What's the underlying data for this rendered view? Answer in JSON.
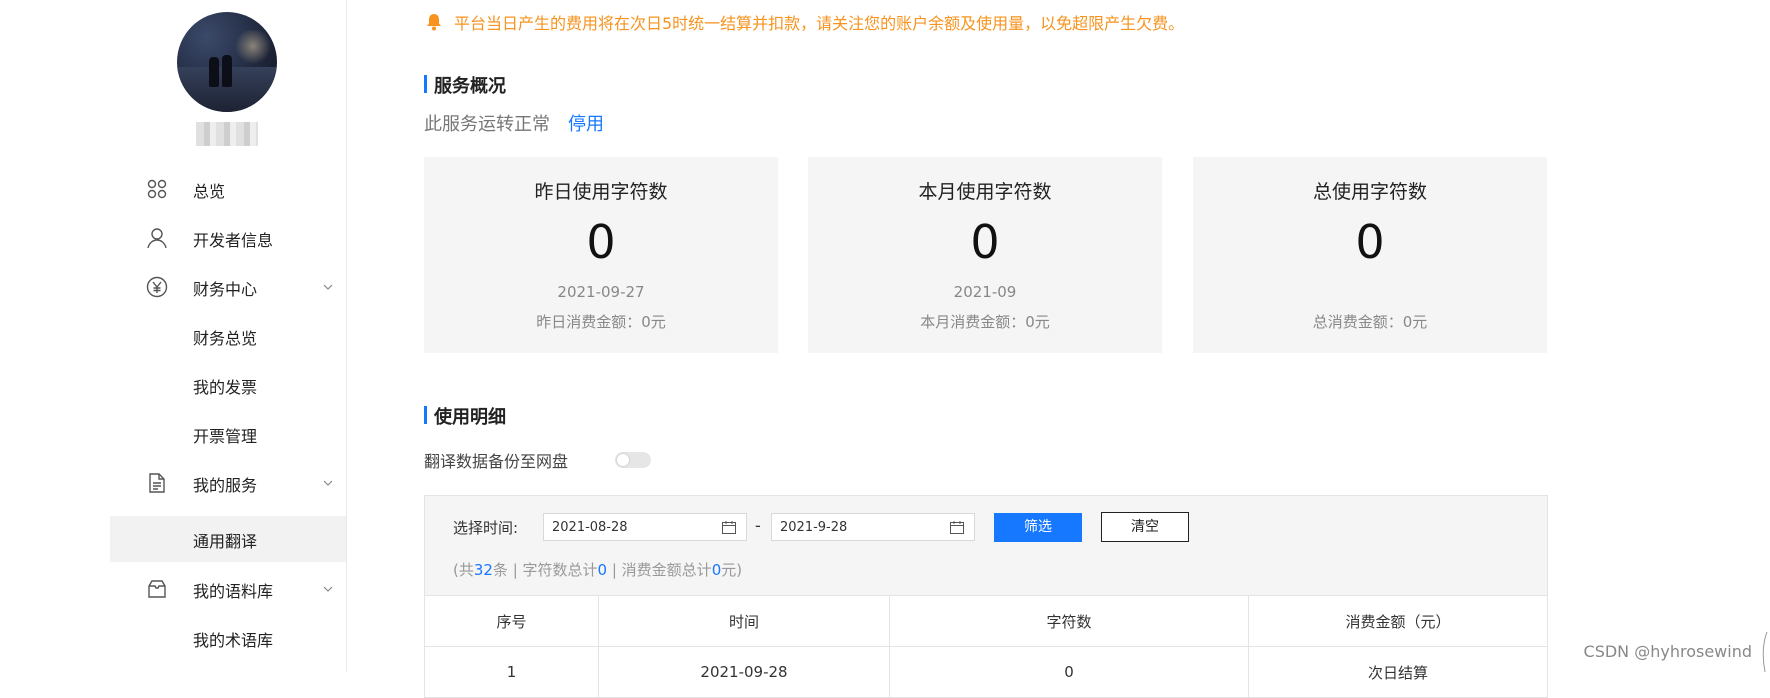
{
  "notice": {
    "text": "平台当日产生的费用将在次日5时统一结算并扣款，请关注您的账户余额及使用量，以免超限产生欠费。",
    "color": "#f7931e",
    "icon": "bell-icon"
  },
  "sidebar": {
    "items": [
      {
        "label": "总览",
        "icon": "grid-icon",
        "has_children": false
      },
      {
        "label": "开发者信息",
        "icon": "user-icon",
        "has_children": false
      },
      {
        "label": "财务中心",
        "icon": "yen-icon",
        "has_children": true
      },
      {
        "label": "财务总览"
      },
      {
        "label": "我的发票"
      },
      {
        "label": "开票管理"
      },
      {
        "label": "我的服务",
        "icon": "document-icon",
        "has_children": true
      },
      {
        "label": "通用翻译",
        "active": true
      },
      {
        "label": "我的语料库",
        "icon": "box-icon",
        "has_children": true
      },
      {
        "label": "我的术语库"
      }
    ]
  },
  "overview": {
    "title": "服务概况",
    "status_text": "此服务运转正常",
    "stop_label": "停用",
    "cards": [
      {
        "title": "昨日使用字符数",
        "value": "0",
        "date": "2021-09-27",
        "fee": "昨日消费金额：0元"
      },
      {
        "title": "本月使用字符数",
        "value": "0",
        "date": "2021-09",
        "fee": "本月消费金额：0元"
      },
      {
        "title": "总使用字符数",
        "value": "0",
        "date": "",
        "fee": "总消费金额：0元"
      }
    ]
  },
  "details": {
    "title": "使用明细",
    "backup_label": "翻译数据备份至网盘",
    "backup_enabled": false,
    "filter": {
      "label": "选择时间:",
      "start": "2021-08-28",
      "end": "2021-9-28",
      "dash": "-",
      "filter_button": "筛选",
      "clear_button": "清空"
    },
    "summary": {
      "prefix": "(共",
      "count": "32",
      "after_count": "条 | 字符数总计",
      "chars": "0",
      "after_chars": " | 消费金额总计",
      "amount": "0",
      "suffix": "元)"
    },
    "table": {
      "headers": [
        "序号",
        "时间",
        "字符数",
        "消费金额（元）"
      ],
      "rows": [
        [
          "1",
          "2021-09-28",
          "0",
          "次日结算"
        ]
      ]
    }
  },
  "watermark": "CSDN @hyhrosewind",
  "colors": {
    "accent": "#1677ff",
    "warning": "#f7931e",
    "card_bg": "#f5f5f5"
  }
}
